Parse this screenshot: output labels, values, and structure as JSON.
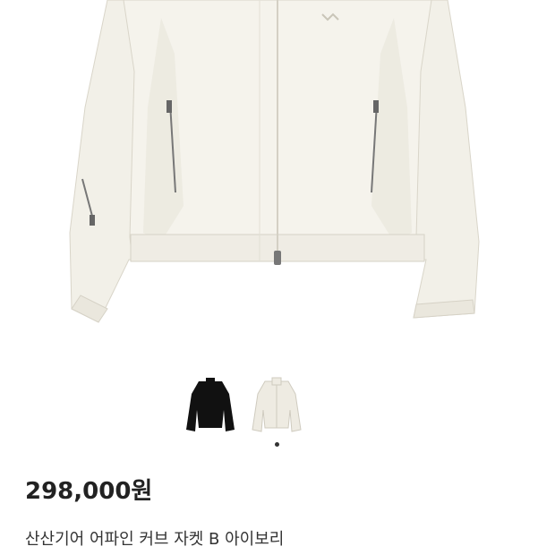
{
  "product": {
    "price": "298,000원",
    "title": "산산기어 어파인 커브 자켓 B 아이보리",
    "main_image": "ivory-jacket-photo",
    "thumbnails": [
      {
        "name": "black",
        "color": "#111111"
      },
      {
        "name": "ivory",
        "color": "#eeebe2"
      }
    ],
    "selected_thumbnail": "ivory"
  },
  "colors": {
    "background": "#ffffff",
    "jacket_ivory": "#f3f1ea",
    "jacket_shadow": "#dedbd0",
    "jacket_black": "#111111",
    "zipper": "#777777",
    "indicator_active": "#333333"
  }
}
